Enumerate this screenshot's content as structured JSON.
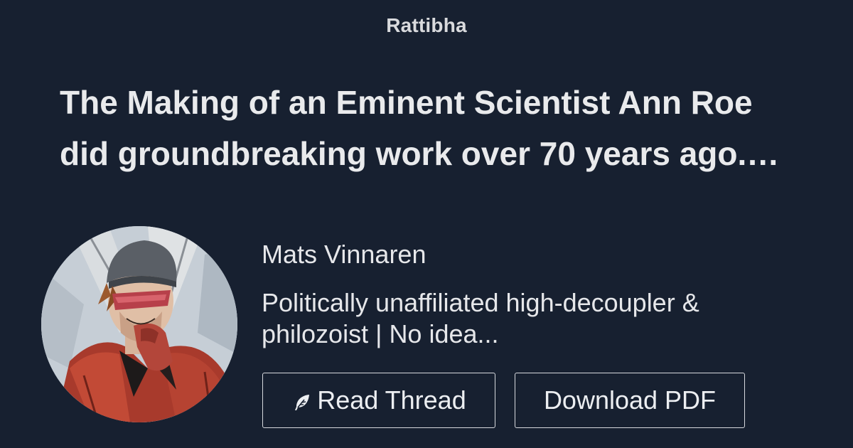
{
  "brand": "Rattibha",
  "title_lines": [
    "The Making of an Eminent Scientist Ann Roe",
    "did groundbreaking work over 70 years ago.…"
  ],
  "author": {
    "name": "Mats Vinnaren",
    "bio_lines": [
      "Politically unaffiliated high-decoupler &",
      "philozoist | No idea..."
    ],
    "avatar_icon": "comic-avatar"
  },
  "buttons": {
    "read_thread": "Read Thread",
    "read_thread_icon": "feather-icon",
    "download_pdf": "Download PDF"
  },
  "colors": {
    "background": "#172030",
    "text": "#e6e7ea",
    "button_border": "#d7d9de"
  }
}
